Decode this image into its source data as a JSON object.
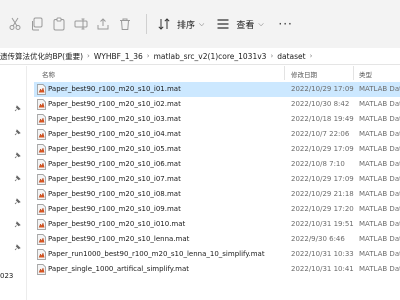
{
  "toolbar": {
    "sort_label": "排序",
    "view_label": "查看",
    "more_label": "···"
  },
  "breadcrumb": {
    "items": [
      "遗传算法优化的BP(重要)",
      "WYHBF_1_36",
      "matlab_src_v2(1)core_1031v3",
      "dataset"
    ]
  },
  "nav": {
    "fragment": "023"
  },
  "columns": {
    "name": "名称",
    "date": "修改日期",
    "type": "类型"
  },
  "files": [
    {
      "name": "Paper_best90_r100_m20_s10_i01.mat",
      "date": "2022/10/29 17:09",
      "type": "MATLAB Data",
      "selected": true
    },
    {
      "name": "Paper_best90_r100_m20_s10_i02.mat",
      "date": "2022/10/30 8:42",
      "type": "MATLAB Data",
      "selected": false
    },
    {
      "name": "Paper_best90_r100_m20_s10_i03.mat",
      "date": "2022/10/18 19:49",
      "type": "MATLAB Data",
      "selected": false
    },
    {
      "name": "Paper_best90_r100_m20_s10_i04.mat",
      "date": "2022/10/7 22:06",
      "type": "MATLAB Data",
      "selected": false
    },
    {
      "name": "Paper_best90_r100_m20_s10_i05.mat",
      "date": "2022/10/29 17:09",
      "type": "MATLAB Data",
      "selected": false
    },
    {
      "name": "Paper_best90_r100_m20_s10_i06.mat",
      "date": "2022/10/8 7:10",
      "type": "MATLAB Data",
      "selected": false
    },
    {
      "name": "Paper_best90_r100_m20_s10_i07.mat",
      "date": "2022/10/29 17:09",
      "type": "MATLAB Data",
      "selected": false
    },
    {
      "name": "Paper_best90_r100_m20_s10_i08.mat",
      "date": "2022/10/29 21:18",
      "type": "MATLAB Data",
      "selected": false
    },
    {
      "name": "Paper_best90_r100_m20_s10_i09.mat",
      "date": "2022/10/29 17:20",
      "type": "MATLAB Data",
      "selected": false
    },
    {
      "name": "Paper_best90_r100_m20_s10_i010.mat",
      "date": "2022/10/31 19:51",
      "type": "MATLAB Data",
      "selected": false
    },
    {
      "name": "Paper_best90_r100_m20_s10_lenna.mat",
      "date": "2022/9/30 6:46",
      "type": "MATLAB Data",
      "selected": false
    },
    {
      "name": "Paper_run1000_best90_r100_m20_s10_lenna_10_simplify.mat",
      "date": "2022/10/31 10:33",
      "type": "MATLAB Data",
      "selected": false
    },
    {
      "name": "Paper_single_1000_artifical_simplify.mat",
      "date": "2022/10/31 10:41",
      "type": "MATLAB Data",
      "selected": false
    }
  ],
  "colors": {
    "toolbar_bg": "#f3f3f3",
    "selected_row": "#cce8ff",
    "secondary_text": "#6b6b6b"
  },
  "icons": [
    "cut-icon",
    "copy-icon",
    "paste-icon",
    "rename-icon",
    "share-icon",
    "delete-icon",
    "sort-icon",
    "view-icon",
    "pin-icon",
    "matlab-file-icon"
  ]
}
